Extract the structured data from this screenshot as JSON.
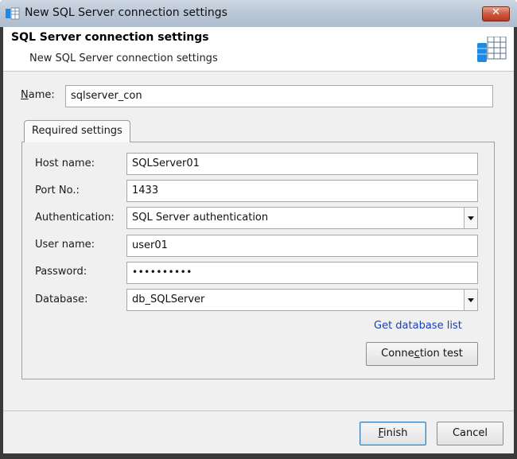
{
  "window": {
    "title": "New SQL Server connection settings",
    "close_label": "✕"
  },
  "header": {
    "title": "SQL Server connection settings",
    "subtitle": "New SQL Server connection settings"
  },
  "name_field": {
    "label_underlined": "N",
    "label_rest": "ame:",
    "value": "sqlserver_con"
  },
  "tabs": [
    {
      "label": "Required settings",
      "selected": true
    }
  ],
  "form": {
    "host": {
      "label": "Host name:",
      "value": "SQLServer01"
    },
    "port": {
      "label": "Port No.:",
      "value": "1433"
    },
    "auth": {
      "label": "Authentication:",
      "value": "SQL Server authentication"
    },
    "user": {
      "label": "User name:",
      "value": "user01"
    },
    "password": {
      "label": "Password:",
      "value": "••••••••••"
    },
    "database": {
      "label": "Database:",
      "value": "db_SQLServer"
    }
  },
  "get_db_list_label": "Get database list",
  "connection_test": {
    "before": "Conne",
    "underlined": "c",
    "after": "tion test"
  },
  "finish": {
    "underlined": "F",
    "rest": "inish"
  },
  "cancel_label": "Cancel",
  "colors": {
    "link": "#1a3fb5",
    "icon_blue": "#1e88e5",
    "close_red": "#c8452b"
  }
}
